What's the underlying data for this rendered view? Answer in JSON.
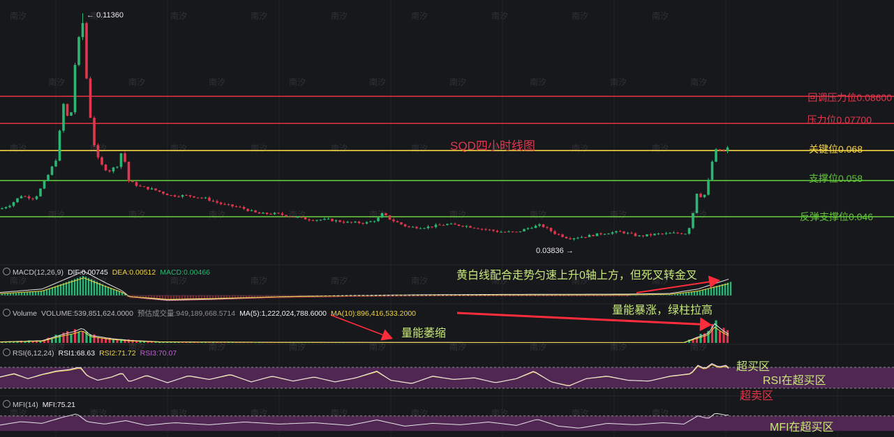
{
  "colors": {
    "background": "#17181b",
    "up": "#2bb673",
    "down": "#e0374e",
    "level_red": "#d9303f",
    "level_yellow": "#f5d442",
    "level_green": "#62c43a",
    "ma_yellow": "#f2d444",
    "ma_white": "#e6e6e6",
    "rsi_band": "#5a2a5c",
    "annotation_green": "#c8e87a",
    "arrow_red": "#ff2c3c"
  },
  "watermark": "南汐",
  "chart_data": {
    "type": "candlestick",
    "title": "SQD四小时线图",
    "high_marker": "0.11360",
    "low_marker": "0.03836",
    "ylim": [
      0.03,
      0.118
    ],
    "price_curve": [
      [
        0,
        0.0485
      ],
      [
        15,
        0.05
      ],
      [
        30,
        0.053
      ],
      [
        50,
        0.052
      ],
      [
        65,
        0.058
      ],
      [
        80,
        0.065
      ],
      [
        92,
        0.085
      ],
      [
        100,
        0.075
      ],
      [
        108,
        0.098
      ],
      [
        113,
        0.105
      ],
      [
        118,
        0.112
      ],
      [
        124,
        0.092
      ],
      [
        130,
        0.078
      ],
      [
        135,
        0.07
      ],
      [
        142,
        0.064
      ],
      [
        155,
        0.061
      ],
      [
        168,
        0.063
      ],
      [
        176,
        0.069
      ],
      [
        183,
        0.058
      ],
      [
        200,
        0.056
      ],
      [
        220,
        0.055
      ],
      [
        245,
        0.053
      ],
      [
        270,
        0.053
      ],
      [
        295,
        0.052
      ],
      [
        320,
        0.05
      ],
      [
        345,
        0.049
      ],
      [
        370,
        0.047
      ],
      [
        395,
        0.047
      ],
      [
        420,
        0.046
      ],
      [
        445,
        0.045
      ],
      [
        470,
        0.045
      ],
      [
        500,
        0.044
      ],
      [
        525,
        0.044
      ],
      [
        540,
        0.045
      ],
      [
        548,
        0.047
      ],
      [
        560,
        0.045
      ],
      [
        585,
        0.0425
      ],
      [
        610,
        0.0425
      ],
      [
        640,
        0.0435
      ],
      [
        665,
        0.043
      ],
      [
        690,
        0.042
      ],
      [
        715,
        0.041
      ],
      [
        740,
        0.0408
      ],
      [
        760,
        0.0425
      ],
      [
        775,
        0.0432
      ],
      [
        795,
        0.0405
      ],
      [
        815,
        0.0388
      ],
      [
        840,
        0.0395
      ],
      [
        865,
        0.0405
      ],
      [
        890,
        0.041
      ],
      [
        915,
        0.0395
      ],
      [
        940,
        0.0402
      ],
      [
        965,
        0.0405
      ],
      [
        985,
        0.0405
      ],
      [
        992,
        0.046
      ],
      [
        998,
        0.054
      ],
      [
        1008,
        0.052
      ],
      [
        1015,
        0.058
      ],
      [
        1022,
        0.066
      ],
      [
        1028,
        0.069
      ],
      [
        1035,
        0.067
      ],
      [
        1042,
        0.069
      ],
      [
        1047,
        0.066
      ]
    ],
    "macd_hist_curve": [
      [
        0,
        0.0005
      ],
      [
        60,
        0.0015
      ],
      [
        100,
        0.005
      ],
      [
        120,
        0.0068
      ],
      [
        150,
        0.0035
      ],
      [
        175,
        0.001
      ],
      [
        185,
        -0.0007
      ],
      [
        240,
        -0.0018
      ],
      [
        300,
        -0.0015
      ],
      [
        400,
        -0.0008
      ],
      [
        500,
        -0.0004
      ],
      [
        600,
        -0.0002
      ],
      [
        700,
        -0.0001
      ],
      [
        800,
        -5e-05
      ],
      [
        900,
        0.0
      ],
      [
        960,
        0.0002
      ],
      [
        1000,
        0.0015
      ],
      [
        1030,
        0.0035
      ],
      [
        1047,
        0.00466
      ]
    ],
    "volume_curve": [
      [
        0,
        0.05
      ],
      [
        60,
        0.1
      ],
      [
        90,
        0.4
      ],
      [
        108,
        0.55
      ],
      [
        118,
        0.7
      ],
      [
        130,
        0.35
      ],
      [
        160,
        0.2
      ],
      [
        185,
        0.12
      ],
      [
        230,
        0.05
      ],
      [
        400,
        0.03
      ],
      [
        700,
        0.02
      ],
      [
        980,
        0.02
      ],
      [
        998,
        0.25
      ],
      [
        1015,
        0.45
      ],
      [
        1024,
        0.9
      ],
      [
        1035,
        0.6
      ],
      [
        1047,
        0.35
      ]
    ],
    "rsi_curve": [
      [
        0,
        52
      ],
      [
        20,
        60
      ],
      [
        40,
        48
      ],
      [
        60,
        58
      ],
      [
        80,
        66
      ],
      [
        100,
        70
      ],
      [
        115,
        76
      ],
      [
        125,
        55
      ],
      [
        140,
        44
      ],
      [
        160,
        52
      ],
      [
        175,
        62
      ],
      [
        185,
        40
      ],
      [
        210,
        56
      ],
      [
        240,
        38
      ],
      [
        270,
        55
      ],
      [
        300,
        46
      ],
      [
        330,
        58
      ],
      [
        360,
        40
      ],
      [
        390,
        54
      ],
      [
        420,
        42
      ],
      [
        450,
        52
      ],
      [
        480,
        40
      ],
      [
        510,
        50
      ],
      [
        540,
        66
      ],
      [
        560,
        44
      ],
      [
        590,
        36
      ],
      [
        620,
        54
      ],
      [
        650,
        46
      ],
      [
        680,
        50
      ],
      [
        710,
        38
      ],
      [
        740,
        48
      ],
      [
        765,
        66
      ],
      [
        790,
        40
      ],
      [
        815,
        30
      ],
      [
        840,
        48
      ],
      [
        870,
        54
      ],
      [
        900,
        44
      ],
      [
        930,
        42
      ],
      [
        960,
        54
      ],
      [
        990,
        60
      ],
      [
        1000,
        80
      ],
      [
        1010,
        72
      ],
      [
        1020,
        84
      ],
      [
        1030,
        76
      ],
      [
        1040,
        80
      ],
      [
        1047,
        70
      ]
    ],
    "mfi_curve": [
      [
        0,
        45
      ],
      [
        30,
        55
      ],
      [
        60,
        50
      ],
      [
        90,
        68
      ],
      [
        110,
        78
      ],
      [
        125,
        55
      ],
      [
        150,
        48
      ],
      [
        180,
        58
      ],
      [
        210,
        44
      ],
      [
        250,
        52
      ],
      [
        300,
        46
      ],
      [
        350,
        54
      ],
      [
        400,
        48
      ],
      [
        450,
        52
      ],
      [
        500,
        44
      ],
      [
        540,
        60
      ],
      [
        580,
        42
      ],
      [
        620,
        50
      ],
      [
        660,
        46
      ],
      [
        700,
        54
      ],
      [
        740,
        44
      ],
      [
        770,
        62
      ],
      [
        800,
        42
      ],
      [
        830,
        36
      ],
      [
        870,
        50
      ],
      [
        910,
        46
      ],
      [
        950,
        52
      ],
      [
        980,
        48
      ],
      [
        1000,
        72
      ],
      [
        1015,
        64
      ],
      [
        1025,
        80
      ],
      [
        1040,
        74
      ],
      [
        1047,
        75
      ]
    ],
    "levels": [
      {
        "label": "回调压力位0.08600",
        "price": 0.086,
        "color": "#d9303f"
      },
      {
        "label": "压力位0.07700",
        "price": 0.077,
        "color": "#d9303f"
      },
      {
        "label": "关键位0.068",
        "price": 0.068,
        "color": "#f5d442"
      },
      {
        "label": "支撑位0.058",
        "price": 0.058,
        "color": "#62c43a"
      },
      {
        "label": "反弹支撑位0.046",
        "price": 0.046,
        "color": "#62c43a"
      }
    ]
  },
  "indicators": {
    "macd": {
      "name": "MACD(12,26,9)",
      "dif": "DIF:0.00745",
      "dea": "DEA:0.00512",
      "macd": "MACD:0.00466"
    },
    "volume": {
      "name": "Volume",
      "volume": "VOLUME:539,851,624.0000",
      "estimate": "预估成交量:949,189,668.5714",
      "ma5": "MA(5):1,222,024,788.6000",
      "ma10": "MA(10):896,416,533.2000"
    },
    "rsi": {
      "name": "RSI(6,12,24)",
      "rsi1": "RSI1:68.63",
      "rsi2": "RSI2:71.72",
      "rsi3": "RSI3:70.07"
    },
    "mfi": {
      "name": "MFI(14)",
      "mfi": "MFI:75.21"
    }
  },
  "annotations": {
    "macd_note": "黄白线配合走势匀速上升0轴上方，但死叉转金叉",
    "volume_shrink": "量能萎缩",
    "volume_surge": "量能暴涨，绿柱拉高",
    "rsi_overbought_zone": "超买区",
    "rsi_note": "RSI在超买区",
    "rsi_oversold_zone": "超卖区",
    "mfi_note": "MFI在超买区"
  }
}
